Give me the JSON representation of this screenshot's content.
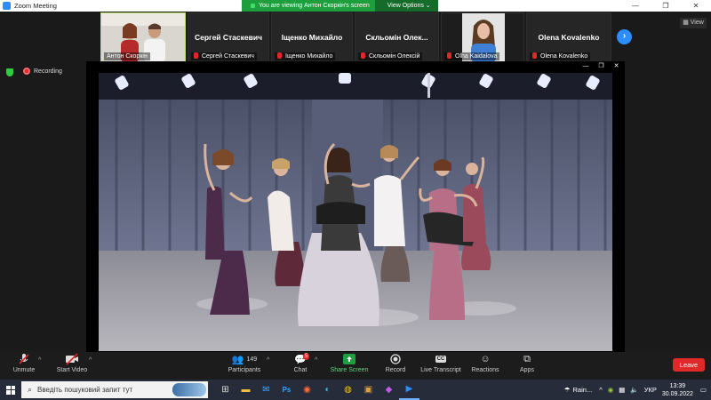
{
  "window": {
    "title": "Zoom Meeting",
    "controls": [
      "—",
      "❐",
      "✕"
    ]
  },
  "share_banner": {
    "message": "You are viewing Антон Скоркін's screen",
    "view_options": "View Options ⌄"
  },
  "participants_strip": {
    "tiles": [
      {
        "type": "video",
        "caption": "Антон Скоркін"
      },
      {
        "type": "name",
        "name": "Сергей Стаскевич",
        "caption": "Сергей Стаскевич"
      },
      {
        "type": "name",
        "name": "Іщенко Михайло",
        "caption": "Іщенко Михайло"
      },
      {
        "type": "name",
        "name": "Скльомін Олек...",
        "caption": "Скльомін Олексій"
      },
      {
        "type": "video",
        "caption": "Olha Kaidalova"
      },
      {
        "type": "name",
        "name": "Olena Kovalenko",
        "caption": "Olena Kovalenko"
      }
    ],
    "next_glyph": "›",
    "view_label": "View"
  },
  "status": {
    "recording_label": "Recording"
  },
  "share_controls": [
    "—",
    "❐",
    "✕"
  ],
  "toolbar": {
    "unmute": "Unmute",
    "start_video": "Start Video",
    "participants": "Participants",
    "participants_count": "149",
    "chat": "Chat",
    "chat_badge": "5",
    "share_screen": "Share Screen",
    "record": "Record",
    "live_transcript": "Live Transcript",
    "live_transcript_icon_text": "CC",
    "reactions": "Reactions",
    "apps": "Apps",
    "leave": "Leave"
  },
  "taskbar": {
    "search_placeholder": "Введіть пошуковий запит тут",
    "weather": "Rain...",
    "language": "УКР",
    "time": "13:39",
    "date": "30.09.2022"
  },
  "colors": {
    "zoom_blue": "#2d8cff",
    "share_green": "#1f9e3e",
    "leave_red": "#e02828",
    "taskbar": "#262c3a"
  }
}
